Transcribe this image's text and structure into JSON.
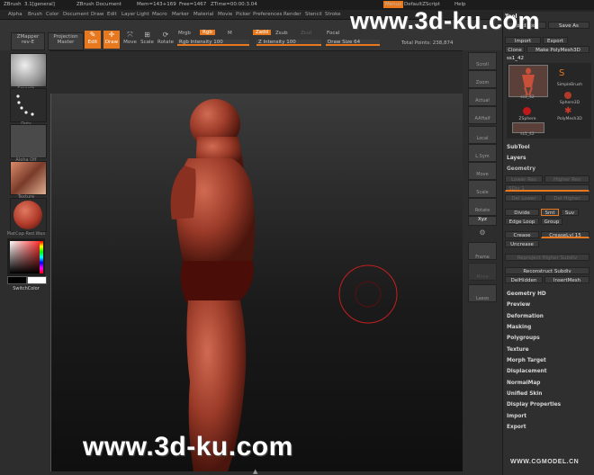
{
  "titlebar": {
    "app": "ZBrush",
    "version": "3.1[general]",
    "document": "ZBrush Document",
    "mem": "Mem=143+169",
    "free": "Free=1467",
    "ztime": "ZTime=00:00:3.04",
    "menus_btn": "Menus",
    "script": "DefaultZScript",
    "help": "Help"
  },
  "menubar": [
    "Alpha",
    "Brush",
    "Color",
    "Document",
    "Draw",
    "Edit",
    "Layer",
    "Light",
    "Macro",
    "Marker",
    "Material",
    "Movie",
    "Picker",
    "Preferences",
    "Render",
    "Stencil",
    "Stroke"
  ],
  "toolbar": {
    "zmapper": "ZMapper",
    "zmapper_sub": "rev-E",
    "projection": "Projection",
    "projection_sub": "Master",
    "edit": "Edit",
    "draw": "Draw",
    "move": "Move",
    "scale": "Scale",
    "rotate": "Rotate",
    "mrgb": "Mrgb",
    "rgb": "Rgb",
    "m": "M",
    "zadd": "Zadd",
    "zsub": "Zsub",
    "zcut": "Zcut",
    "focal": "Focal",
    "rgb_intensity": "Rgb Intensity 100",
    "z_intensity": "Z Intensity 100",
    "draw_size": "Draw Size 64",
    "total_points": "Total Points: 238,874"
  },
  "left_shelf": [
    {
      "caption": "Smooth"
    },
    {
      "caption": "Dots"
    },
    {
      "caption": "Alpha Off"
    },
    {
      "caption": "Texture"
    },
    {
      "caption": "MatCap Red Wax"
    }
  ],
  "color_picker": {
    "switch_label": "SwitchColor"
  },
  "right_shelf": [
    "Scroll",
    "Zoom",
    "Actual",
    "AAHalf",
    "Local",
    "L.Sym",
    "Move",
    "Scale",
    "Rotate",
    "Xyz",
    "",
    "",
    "Frame",
    "Move",
    "",
    "Lasso"
  ],
  "tool_panel": {
    "title": "Tool",
    "load": "Load Tool",
    "save": "Save As",
    "import": "Import",
    "export": "Export",
    "clone": "Clone",
    "make": "Make PolyMesh3D",
    "current": "ss1_42",
    "tools": [
      "ss1_42",
      "SimpleBrush",
      "Sphere3D",
      "ZSphere",
      "PolyMesh3D",
      "ss1_42"
    ],
    "subtool": "SubTool",
    "layers": "Layers",
    "geometry": "Geometry",
    "lower_res": "Lower Res",
    "higher_res": "Higher Res",
    "sdiv": "SDiv 1",
    "del_lower": "Del Lower",
    "del_higher": "Del Higher",
    "divide": "Divide",
    "smt": "Smt",
    "suv": "Suv",
    "edge_loop": "Edge Loop",
    "group": "Group",
    "crease": "Crease",
    "crease_lvl": "CreaseLvl 15",
    "uncrease": "Uncrease",
    "reproject": "Reproject Higher Subdiv",
    "reconstruct": "Reconstruct Subdiv",
    "delhidden": "DelHidden",
    "insertmesh": "InsertMesh",
    "sections": [
      "Geometry HD",
      "Preview",
      "Deformation",
      "Masking",
      "Polygroups",
      "Texture",
      "Morph Target",
      "Displacement",
      "NormalMap",
      "Unified Skin",
      "Display Properties",
      "Import",
      "Export"
    ]
  },
  "watermarks": {
    "top": "www.3d-ku.com",
    "bottom": "www.3d-ku.com",
    "corner": "WWW.CGMODEL.CN"
  },
  "colors": {
    "accent": "#e8781e",
    "background": "#2b2b2b"
  }
}
